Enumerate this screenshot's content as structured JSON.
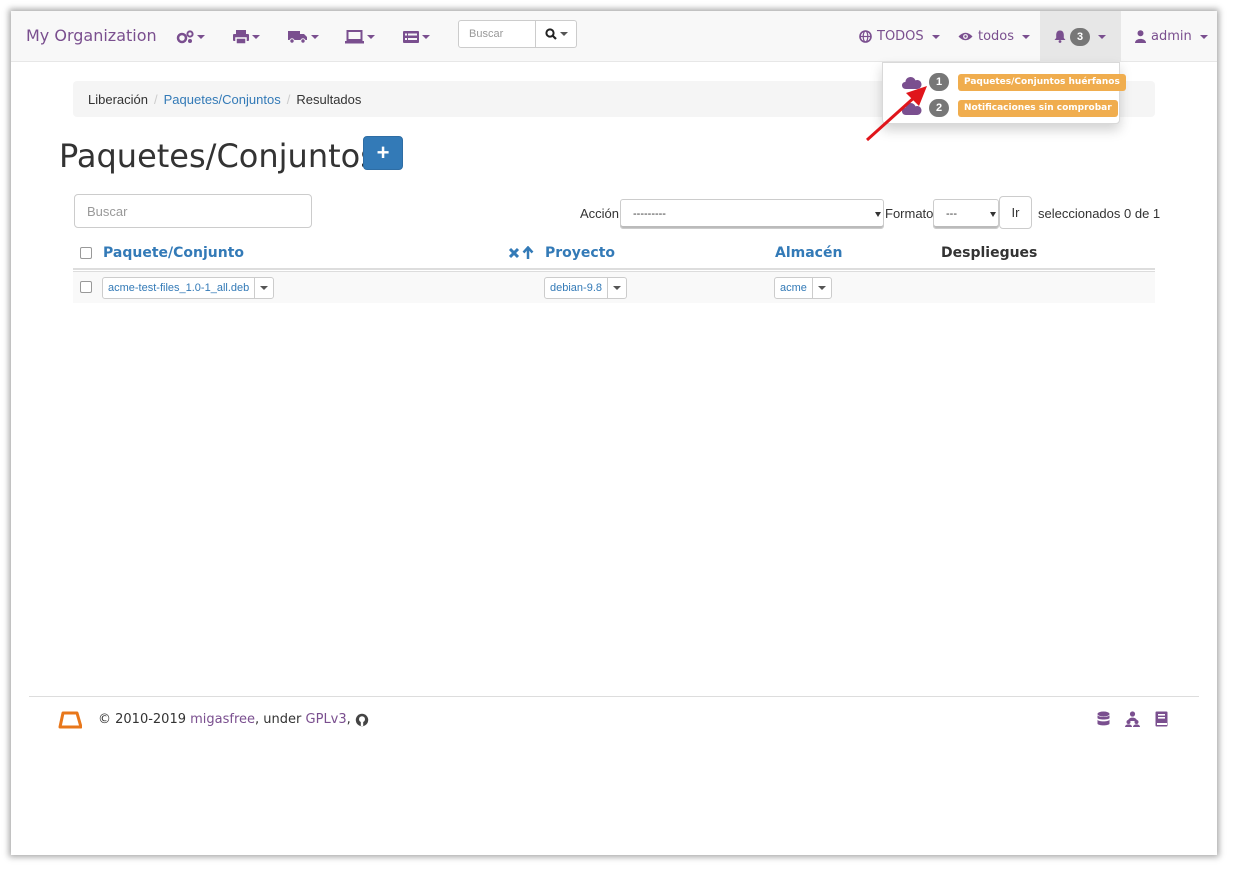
{
  "navbar": {
    "brand": "My Organization",
    "menus": [
      {
        "icon": "cogs-icon"
      },
      {
        "icon": "printer-icon"
      },
      {
        "icon": "truck-icon"
      },
      {
        "icon": "laptop-icon"
      },
      {
        "icon": "list-icon"
      }
    ],
    "search": {
      "placeholder": "Buscar",
      "icon": "search-icon"
    },
    "project_filter": {
      "icon": "globe-icon",
      "label": "TODOS"
    },
    "domain_filter": {
      "icon": "eye-icon",
      "label": "todos"
    },
    "alerts": {
      "icon": "bell-icon",
      "count": "3"
    },
    "user": {
      "icon": "user-icon",
      "label": "admin"
    }
  },
  "alerts_dropdown": {
    "items": [
      {
        "icon": "cloud-icon",
        "count": "1",
        "label": "Paquetes/Conjuntos huérfanos"
      },
      {
        "icon": "cloud-icon",
        "count": "2",
        "label": "Notificaciones sin comprobar"
      }
    ]
  },
  "breadcrumb": {
    "items": [
      "Liberación",
      "Paquetes/Conjuntos",
      "Resultados"
    ]
  },
  "page": {
    "title": "Paquetes/Conjuntos",
    "add_label": "+"
  },
  "filter": {
    "placeholder": "Buscar"
  },
  "actions": {
    "action_label": "Acción:",
    "action_value": "---------",
    "format_label": "Formato",
    "format_value": "---",
    "go_label": "Ir",
    "selection_text": "seleccionados 0 de 1"
  },
  "table": {
    "headers": [
      "Paquete/Conjunto",
      "Proyecto",
      "Almacén",
      "Despliegues"
    ],
    "rows": [
      {
        "package": "acme-test-files_1.0-1_all.deb",
        "project": "debian-9.8",
        "store": "acme",
        "deployments": ""
      }
    ]
  },
  "footer": {
    "copyright": "© 2010-2019",
    "product": "migasfree",
    "under": ", under",
    "license": "GPLv3",
    "comma": ",",
    "icons": [
      "database-icon",
      "sitemap-icon",
      "book-icon"
    ]
  },
  "colors": {
    "brand_purple": "#7a4f8f",
    "link_blue": "#337ab7",
    "warning_orange": "#f0ad4e",
    "badge_grey": "#777777",
    "annotation_red": "#e0151b"
  }
}
